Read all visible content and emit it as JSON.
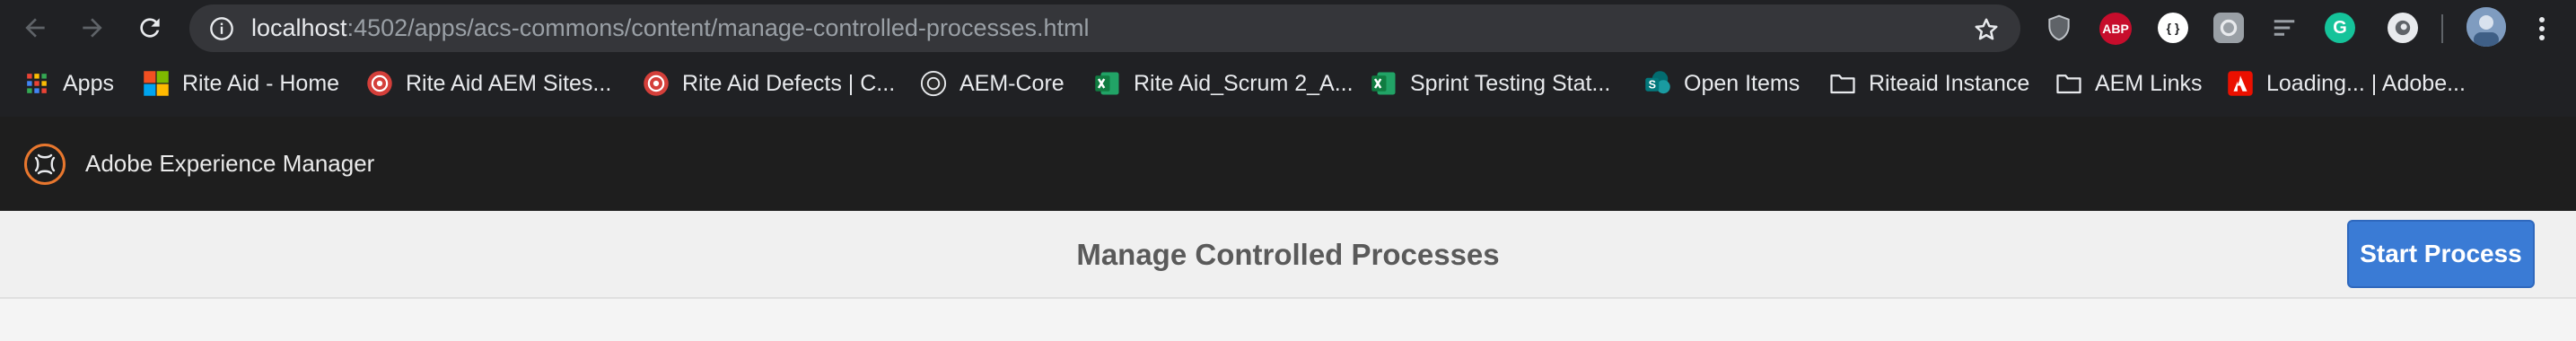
{
  "browser": {
    "url_host": "localhost",
    "url_rest": ":4502/apps/acs-commons/content/manage-controlled-processes.html",
    "extensions": [
      {
        "name": "privacy-shield-icon",
        "label": "",
        "color": "#5f6368"
      },
      {
        "name": "adblock-plus-icon",
        "label": "ABP",
        "color": "#c70d2c"
      },
      {
        "name": "json-formatter-icon",
        "label": "{ }",
        "color": "#ffffff"
      },
      {
        "name": "extension-settings-icon",
        "label": "",
        "color": "#9aa0a6"
      },
      {
        "name": "list-extension-icon",
        "label": "",
        "color": "#9aa0a6"
      },
      {
        "name": "grammarly-icon",
        "label": "G",
        "color": "#15c39a"
      },
      {
        "name": "circle-extension-icon",
        "label": "",
        "color": "#bdc1c6"
      }
    ]
  },
  "bookmarks": [
    {
      "label": "Apps",
      "icon": "apps-grid-icon"
    },
    {
      "label": "Rite Aid - Home",
      "icon": "microsoft-icon"
    },
    {
      "label": "Rite Aid AEM Sites...",
      "icon": "red-target-icon"
    },
    {
      "label": "Rite Aid Defects | C...",
      "icon": "red-target-icon"
    },
    {
      "label": "AEM-Core",
      "icon": "github-icon"
    },
    {
      "label": "Rite Aid_Scrum 2_A...",
      "icon": "excel-icon"
    },
    {
      "label": "Sprint Testing Stat...",
      "icon": "excel-icon"
    },
    {
      "label": "Open Items",
      "icon": "sharepoint-icon"
    },
    {
      "label": "Riteaid Instance",
      "icon": "folder-icon"
    },
    {
      "label": "AEM Links",
      "icon": "folder-icon"
    },
    {
      "label": "Loading... | Adobe...",
      "icon": "adobe-icon"
    }
  ],
  "aem": {
    "product_title": "Adobe Experience Manager",
    "page_title": "Manage Controlled Processes",
    "start_button_label": "Start Process"
  },
  "colors": {
    "browser_chrome": "#202124",
    "shell": "#1e1e1e",
    "primary_button": "#3a7bd5",
    "aem_logo": "#e8772e"
  }
}
